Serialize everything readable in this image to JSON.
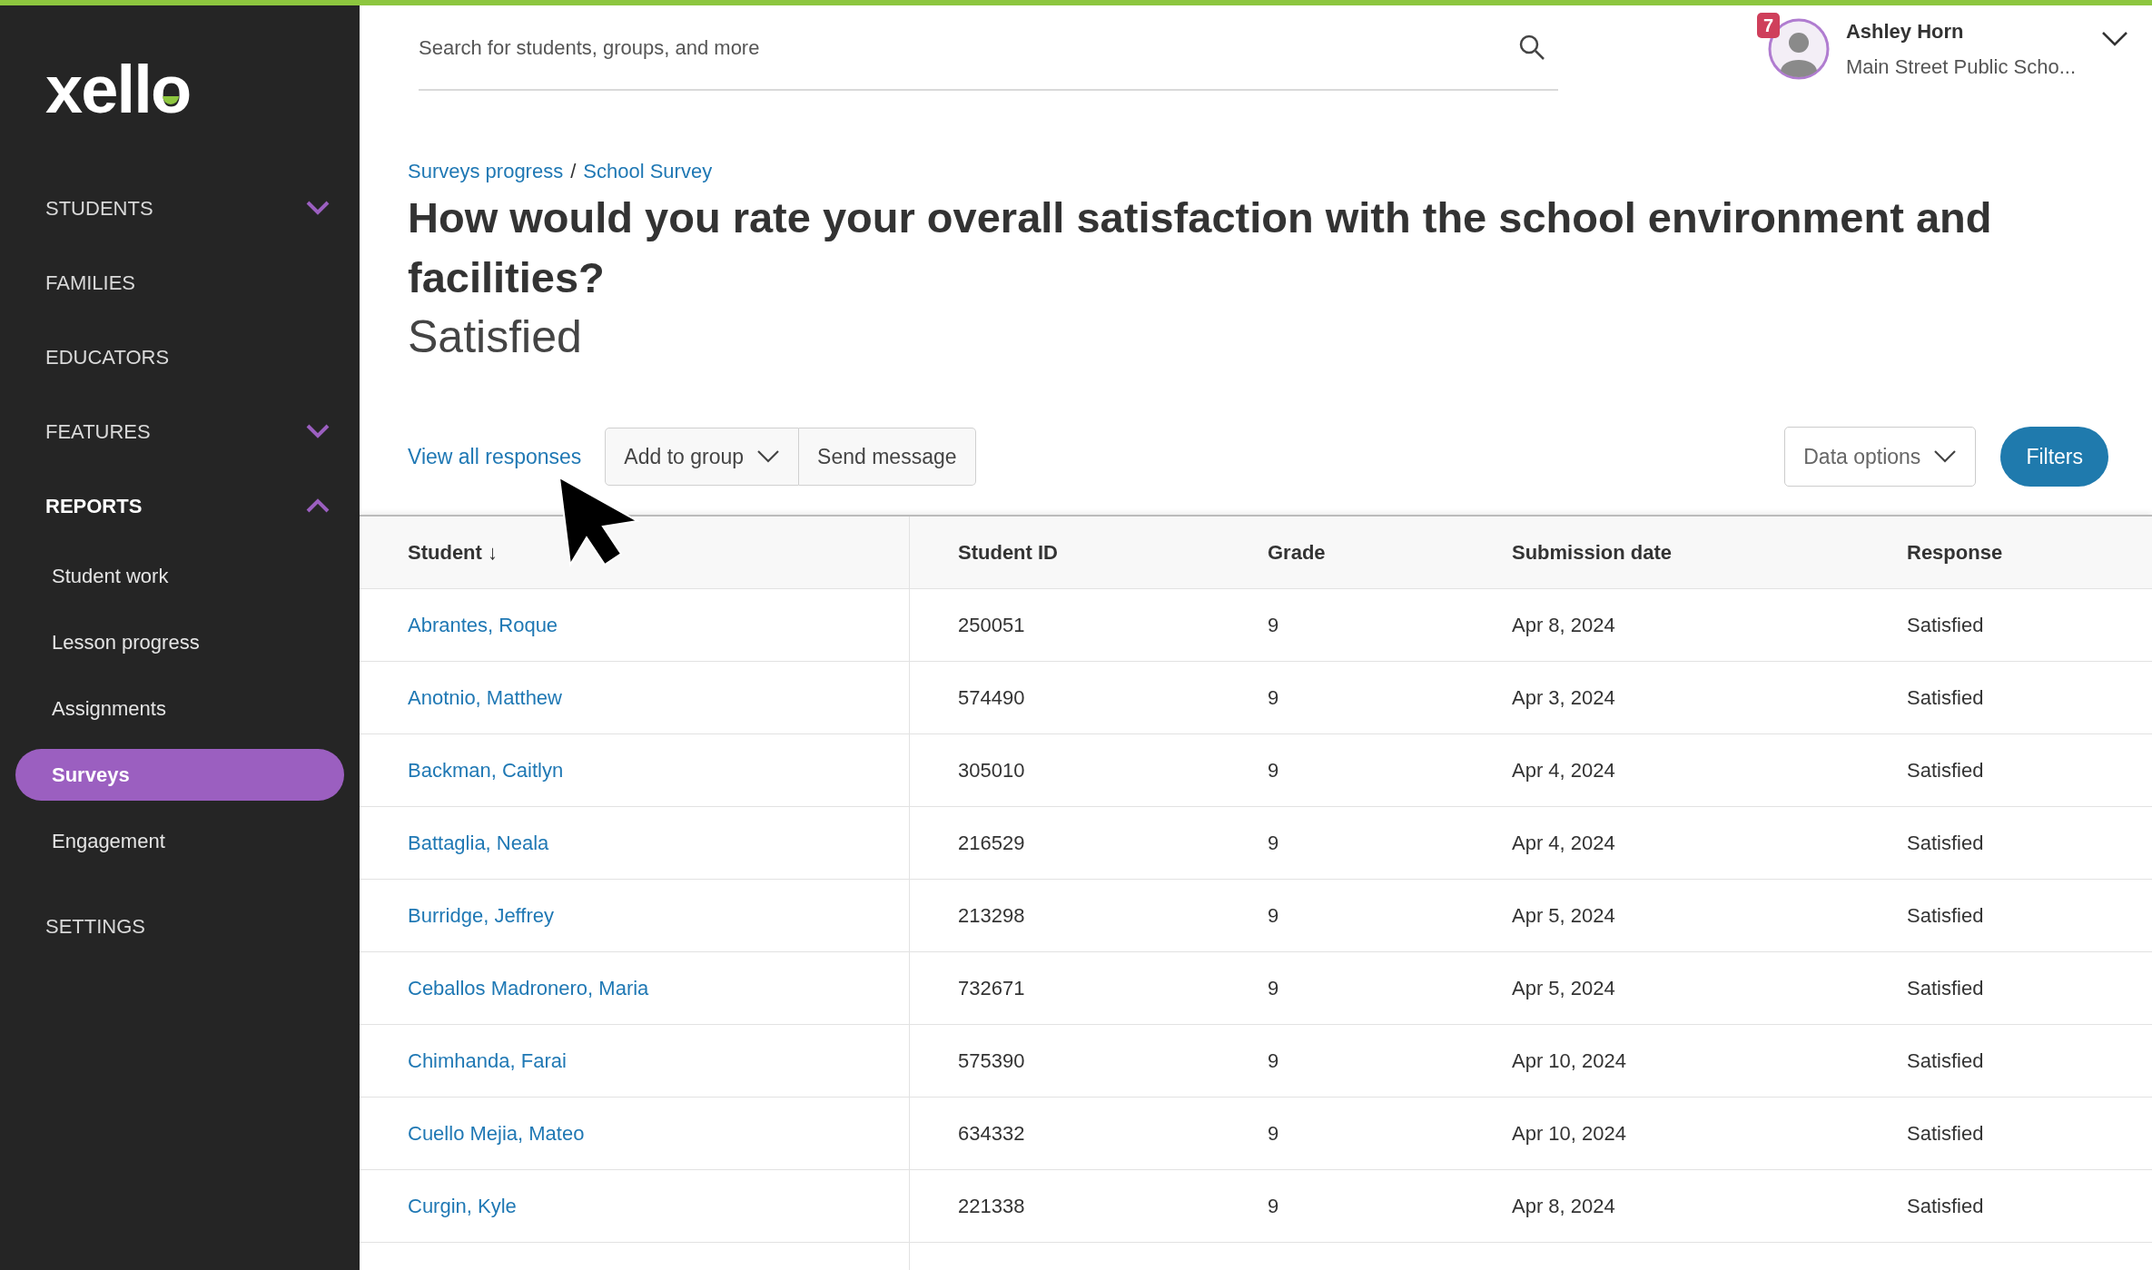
{
  "sidebar": {
    "logo": "xello",
    "items": [
      {
        "label": "STUDENTS",
        "expanded": false,
        "selected": false
      },
      {
        "label": "FAMILIES",
        "selected": false
      },
      {
        "label": "EDUCATORS",
        "selected": false
      },
      {
        "label": "FEATURES",
        "expanded": false,
        "selected": false
      },
      {
        "label": "REPORTS",
        "expanded": true,
        "selected": true,
        "children": [
          {
            "label": "Student work",
            "selected": false
          },
          {
            "label": "Lesson progress",
            "selected": false
          },
          {
            "label": "Assignments",
            "selected": false
          },
          {
            "label": "Surveys",
            "selected": true
          },
          {
            "label": "Engagement",
            "selected": false
          }
        ]
      },
      {
        "label": "SETTINGS",
        "selected": false
      }
    ]
  },
  "header": {
    "search": {
      "placeholder": "Search for students, groups, and more"
    },
    "user": {
      "name": "Ashley Horn",
      "school": "Main Street Public Scho...",
      "notification_count": "7"
    }
  },
  "breadcrumb": {
    "separator": "/",
    "items": [
      "Surveys progress",
      "School Survey"
    ]
  },
  "question": "How would you rate your overall satisfaction with the school environment and facilities?",
  "answer": "Satisfied",
  "toolbar": {
    "link": "View all responses",
    "add_to_group": "Add to group",
    "send_message": "Send message",
    "data_options": "Data options",
    "filters": "Filters"
  },
  "table": {
    "columns": [
      {
        "label": "Student",
        "sort_arrow": "↓"
      },
      {
        "label": "Student ID"
      },
      {
        "label": "Grade"
      },
      {
        "label": "Submission date"
      },
      {
        "label": "Response"
      }
    ],
    "rows": [
      [
        "Abrantes, Roque",
        "250051",
        "9",
        "Apr 8, 2024",
        "Satisfied"
      ],
      [
        "Anotnio, Matthew",
        "574490",
        "9",
        "Apr 3, 2024",
        "Satisfied"
      ],
      [
        "Backman, Caitlyn",
        "305010",
        "9",
        "Apr 4, 2024",
        "Satisfied"
      ],
      [
        "Battaglia, Neala",
        "216529",
        "9",
        "Apr 4, 2024",
        "Satisfied"
      ],
      [
        "Burridge, Jeffrey",
        "213298",
        "9",
        "Apr 5, 2024",
        "Satisfied"
      ],
      [
        "Ceballos Madronero, Maria",
        "732671",
        "9",
        "Apr 5, 2024",
        "Satisfied"
      ],
      [
        "Chimhanda, Farai",
        "575390",
        "9",
        "Apr 10, 2024",
        "Satisfied"
      ],
      [
        "Cuello Mejia, Mateo",
        "634332",
        "9",
        "Apr 10, 2024",
        "Satisfied"
      ],
      [
        "Curgin, Kyle",
        "221338",
        "9",
        "Apr 8, 2024",
        "Satisfied"
      ]
    ]
  }
}
